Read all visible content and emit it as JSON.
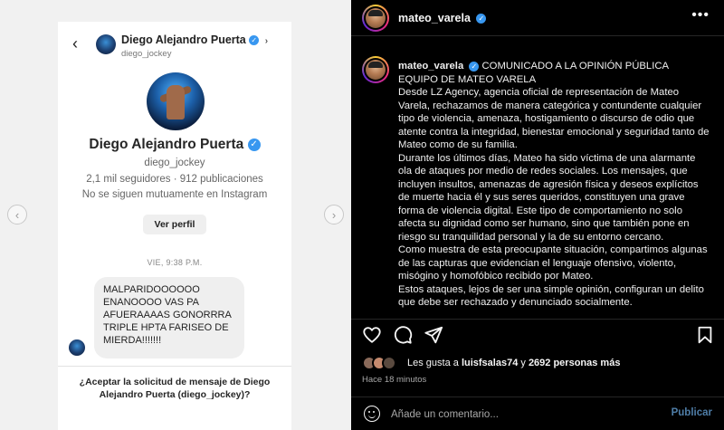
{
  "dm": {
    "header_name": "Diego Alejandro Puerta",
    "header_handle": "diego_jockey",
    "profile_name": "Diego Alejandro Puerta",
    "profile_handle": "diego_jockey",
    "profile_stats": "2,1 mil seguidores · 912 publicaciones",
    "profile_mutual": "No se siguen mutuamente en Instagram",
    "view_profile_label": "Ver perfil",
    "timestamp": "VIE, 9:38 P.M.",
    "message": "MALPARIDOOOOOO ENANOOOO VAS PA AFUERAAAAS GONORRRA TRIPLE HPTA FARISEO DE MIERDA!!!!!!!",
    "accept_prompt": "¿Aceptar la solicitud de mensaje de Diego Alejandro Puerta (diego_jockey)?"
  },
  "post": {
    "username": "mateo_varela",
    "more_icon": "more-horizontal-icon",
    "caption_title_1": "COMUNICADO A LA OPINIÓN PÚBLICA",
    "caption_title_2": "EQUIPO DE MATEO VARELA",
    "paragraphs": [
      "Desde LZ Agency, agencia oficial de representación de Mateo Varela, rechazamos de manera categórica y contundente cualquier tipo de violencia, amenaza, hostigamiento o discurso de odio que atente contra la integridad, bienestar emocional y seguridad tanto de Mateo como de su familia.",
      "Durante los últimos días, Mateo ha sido víctima de una alarmante ola de ataques por medio de redes sociales. Los mensajes, que incluyen insultos, amenazas de agresión física y deseos explícitos de muerte hacia él y sus seres queridos, constituyen una grave forma de violencia digital. Este tipo de comportamiento no solo afecta su dignidad como ser humano, sino que también pone en riesgo su tranquilidad personal y la de su entorno cercano.",
      "Como muestra de esta preocupante situación, compartimos algunas de las capturas que evidencian el lenguaje ofensivo, violento, misógino y homofóbico recibido por Mateo.",
      "Estos ataques, lejos de ser una simple opinión, configuran un delito que debe ser rechazado y denunciado socialmente."
    ],
    "likes_prefix": "Les gusta a",
    "likes_user": "luisfsalas74",
    "likes_conj": "y",
    "likes_count": "2692 personas más",
    "time_ago": "Hace 18 minutos",
    "comment_placeholder": "Añade un comentario...",
    "publish_label": "Publicar"
  }
}
